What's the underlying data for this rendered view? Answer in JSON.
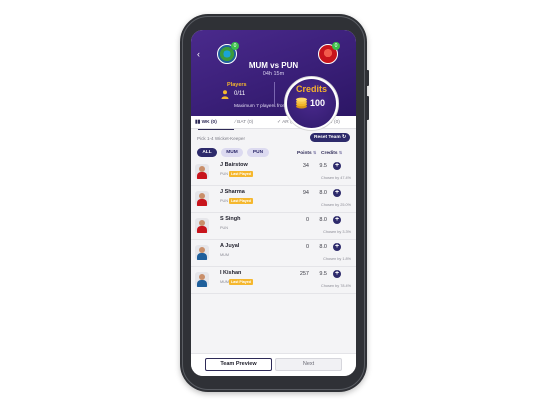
{
  "header": {
    "back_icon": "back-arrow-icon",
    "match_title": "MUM vs PUN",
    "match_time": "04h 15m",
    "players_label": "Players",
    "players_count": "0/11",
    "max_note": "Maximum 7 players from a team",
    "credits_label": "Credits",
    "credits_value": "100",
    "team_badge": "0",
    "colors": {
      "header": "#3a1f78",
      "accent": "#f5b72e",
      "primary": "#2d2a6b"
    }
  },
  "tabs": [
    {
      "label": "WK (0)",
      "icon": "wicketkeeper-icon"
    },
    {
      "label": "BAT (0)",
      "icon": "bat-icon"
    },
    {
      "label": "AR (0)",
      "icon": "allrounder-icon"
    },
    {
      "label": "BOW (0)",
      "icon": "ball-icon"
    }
  ],
  "pick_text": "Pick 1-4 Wicket-Keeper",
  "reset_label": "Reset Team",
  "filters": [
    "ALL",
    "MUM",
    "PUN"
  ],
  "columns": {
    "points": "Points",
    "credits": "Credits"
  },
  "players": [
    {
      "name": "J Bairstow",
      "team": "PUN",
      "last_played": "Last Played",
      "points": "34",
      "credits": "9.5",
      "chosen": "Chosen by 47.4%",
      "jersey": "#c8141c"
    },
    {
      "name": "J Sharma",
      "team": "PUN",
      "last_played": "Last Played",
      "points": "94",
      "credits": "8.0",
      "chosen": "Chosen by 25.0%",
      "jersey": "#c8141c"
    },
    {
      "name": "S Singh",
      "team": "PUN",
      "last_played": "",
      "points": "0",
      "credits": "8.0",
      "chosen": "Chosen by 3.3%",
      "jersey": "#c8141c"
    },
    {
      "name": "A Juyal",
      "team": "MUM",
      "last_played": "",
      "points": "0",
      "credits": "8.0",
      "chosen": "Chosen by 1.8%",
      "jersey": "#1f5f9b"
    },
    {
      "name": "I Kishan",
      "team": "MUM",
      "last_played": "Last Played",
      "points": "257",
      "credits": "9.5",
      "chosen": "Chosen by 78.4%",
      "jersey": "#1f5f9b"
    }
  ],
  "bottom": {
    "preview_label": "Team Preview",
    "next_label": "Next"
  }
}
